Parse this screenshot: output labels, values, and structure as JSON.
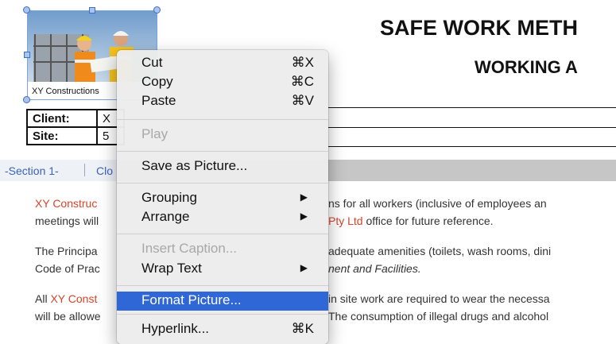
{
  "document": {
    "title_line1": "SAFE WORK METH",
    "title_line2": "WORKING A",
    "picture_caption": "XY Constructions",
    "client_label": "Client:",
    "client_value": "X",
    "site_label": "Site:",
    "site_value": "5"
  },
  "section_bar": {
    "section1": "-Section 1-",
    "section2": "Clo"
  },
  "paragraphs": [
    {
      "l1a": "XY Construc",
      "l1b": "ns for all workers (inclusive of employees an",
      "l2a": "meetings will",
      "l2b_red": "Pty Ltd",
      "l2c": " office for future reference."
    },
    {
      "l1a": "The Principa",
      "l1b": "adequate amenities (toilets, wash rooms, dini",
      "l2a": "Code of Prac",
      "l2b": "nent and Facilities."
    },
    {
      "l1a": "All ",
      "l1a_red": "XY Const",
      "l1b": " in site work are required to wear the necessa",
      "l2a": "will be allowe",
      "l2b": "The consumption of illegal drugs and alcohol"
    }
  ],
  "context_menu": {
    "cut": "Cut",
    "cut_sc": "⌘X",
    "copy": "Copy",
    "copy_sc": "⌘C",
    "paste": "Paste",
    "paste_sc": "⌘V",
    "play": "Play",
    "save_as_picture": "Save as Picture...",
    "grouping": "Grouping",
    "arrange": "Arrange",
    "insert_caption": "Insert Caption...",
    "wrap_text": "Wrap Text",
    "format_picture": "Format Picture...",
    "hyperlink": "Hyperlink...",
    "hyperlink_sc": "⌘K",
    "submenu_arrow": "▶"
  },
  "colors": {
    "accent_red": "#d9432a",
    "link_blue": "#3b63b8",
    "highlight": "#2f67d6"
  }
}
